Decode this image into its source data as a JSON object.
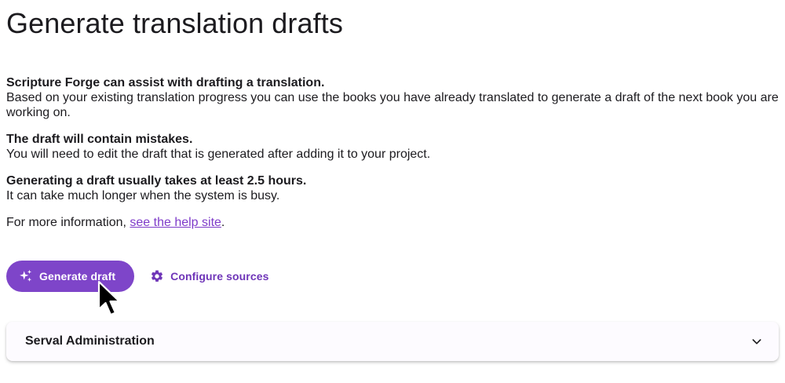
{
  "page": {
    "title": "Generate translation drafts"
  },
  "info": [
    {
      "heading": "Scripture Forge can assist with drafting a translation.",
      "body": "Based on your existing translation progress you can use the books you have already translated to generate a draft of the next book you are working on."
    },
    {
      "heading": "The draft will contain mistakes.",
      "body": "You will need to edit the draft that is generated after adding it to your project."
    },
    {
      "heading": "Generating a draft usually takes at least 2.5 hours.",
      "body": "It can take much longer when the system is busy."
    }
  ],
  "help": {
    "prefix": "For more information, ",
    "link": "see the help site",
    "suffix": "."
  },
  "actions": {
    "generate_label": "Generate draft",
    "generate_icon": "sparkle-icon",
    "configure_label": "Configure sources",
    "configure_icon": "gear-icon"
  },
  "panel": {
    "title": "Serval Administration",
    "icon": "chevron-down-icon"
  },
  "colors": {
    "primary": "#7e45c9",
    "link": "#7e3bc9",
    "text": "#1c1b1f"
  }
}
